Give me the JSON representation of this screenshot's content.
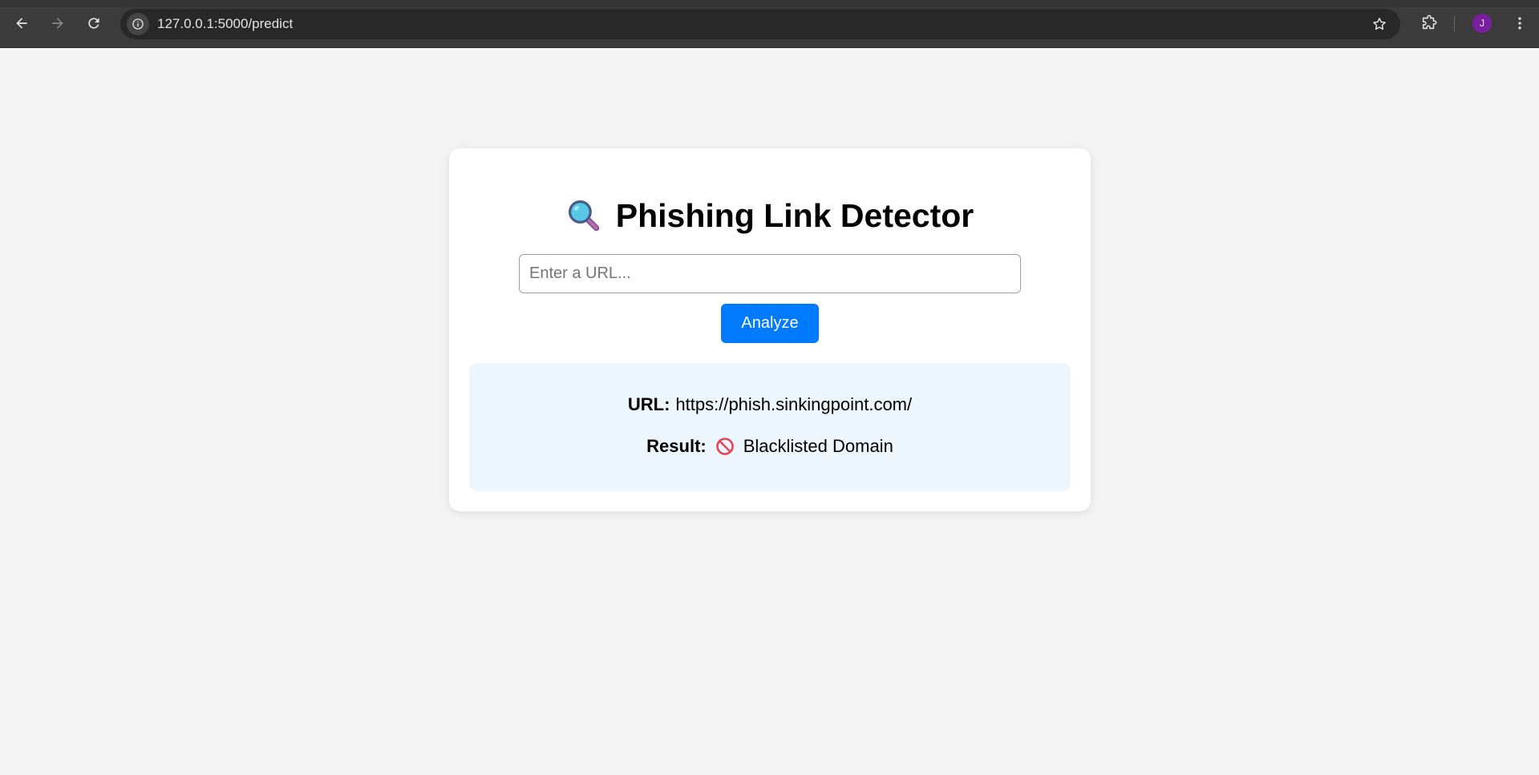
{
  "browser": {
    "url": "127.0.0.1:5000/predict",
    "profile_initial": "J",
    "profile_color": "#7b1fa2"
  },
  "page": {
    "title": "Phishing Link Detector",
    "title_icon": "magnifying-glass-icon",
    "input_placeholder": "Enter a URL...",
    "input_value": "",
    "analyze_label": "Analyze",
    "accent_color": "#007bff"
  },
  "result": {
    "url_label": "URL:",
    "url_value": "https://phish.sinkingpoint.com/",
    "result_label": "Result:",
    "result_icon": "prohibited-icon",
    "result_value": "Blacklisted Domain"
  }
}
